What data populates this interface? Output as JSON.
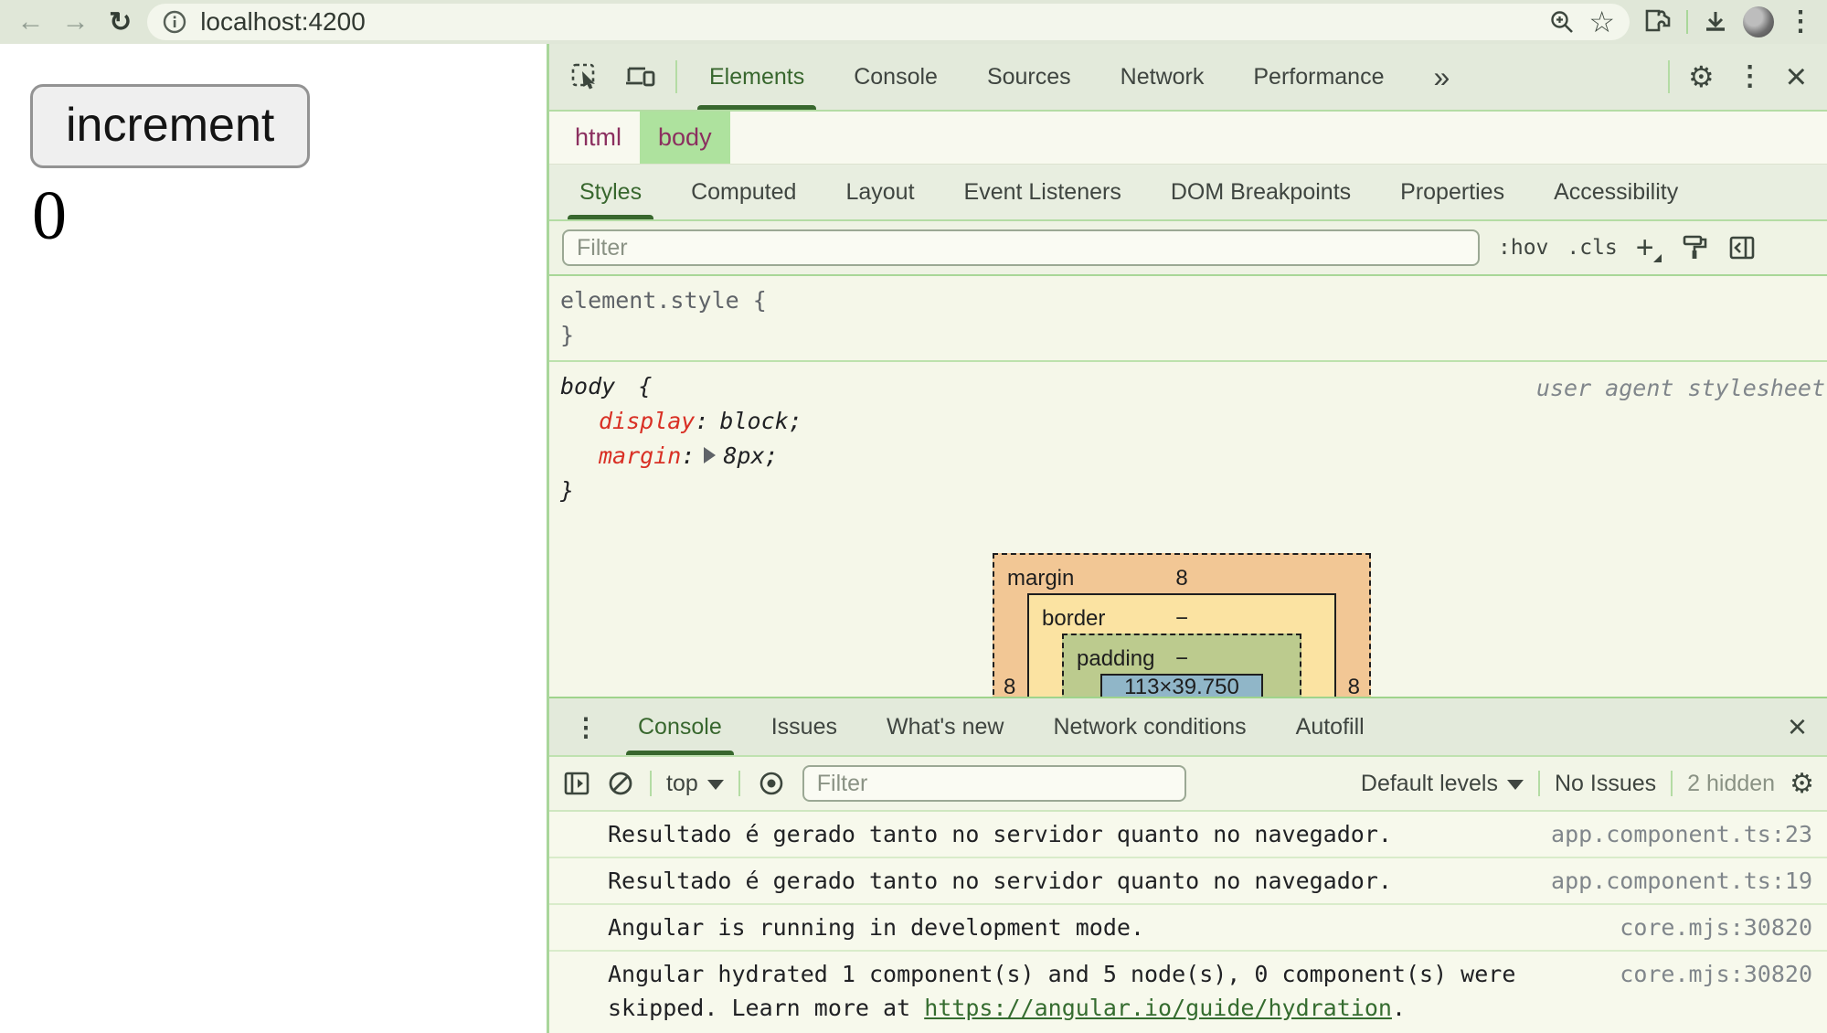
{
  "browser": {
    "url": "localhost:4200"
  },
  "page": {
    "button_label": "increment",
    "counter_value": "0"
  },
  "devtools": {
    "tabs": [
      "Elements",
      "Console",
      "Sources",
      "Network",
      "Performance"
    ],
    "more_tabs_glyph": "»",
    "breadcrumbs": [
      "html",
      "body"
    ],
    "styles_tabs": [
      "Styles",
      "Computed",
      "Layout",
      "Event Listeners",
      "DOM Breakpoints",
      "Properties",
      "Accessibility"
    ],
    "filter_placeholder": "Filter",
    "pseudo_toggle": ":hov",
    "class_toggle": ".cls",
    "plus_glyph": "+",
    "styles_pane": {
      "element_style_selector": "element.style",
      "syntax": {
        "open_brace": "{",
        "close_brace": "}",
        "colon": ":",
        "semicolon": ";"
      },
      "rule": {
        "selector": "body",
        "origin": "user agent stylesheet",
        "declarations": [
          {
            "property": "display",
            "value": "block"
          },
          {
            "property": "margin",
            "value": "8px"
          }
        ]
      }
    },
    "box_model": {
      "margin_label": "margin",
      "margin_top_value": "8",
      "margin_left_value": "8",
      "margin_right_value": "8",
      "border_label": "border",
      "border_top_value": "−",
      "padding_label": "padding",
      "padding_top_value": "−",
      "content_size": "113×39.750"
    }
  },
  "drawer": {
    "tabs": [
      "Console",
      "Issues",
      "What's new",
      "Network conditions",
      "Autofill"
    ],
    "toolbar": {
      "context_selector": "top",
      "filter_placeholder": "Filter",
      "levels_selector": "Default levels",
      "issues_label": "No Issues",
      "hidden_label": "2 hidden"
    },
    "messages": [
      {
        "text": "Resultado é gerado tanto no servidor quanto no navegador.",
        "source": "app.component.ts:23"
      },
      {
        "text": "Resultado é gerado tanto no servidor quanto no navegador.",
        "source": "app.component.ts:19"
      },
      {
        "text": "Angular is running in development mode.",
        "source": "core.mjs:30820"
      },
      {
        "text_before": "Angular hydrated 1 component(s) and 5 node(s), 0 component(s) were skipped. Learn more at ",
        "link": "https://angular.io/guide/hydration",
        "text_after": ".",
        "source": "core.mjs:30820"
      }
    ]
  },
  "colors": {
    "accent_green": "#38672e",
    "toolbar_bg": "#e3eadb",
    "browser_toolbar_bg": "#e0e7d8",
    "content_bg": "#f5f7e9",
    "tag_color": "#8b2f5f",
    "selected_crumb_bg": "#aee29e",
    "property_red": "#d93025",
    "link_green": "#356c2f",
    "box_margin": "#f2c795",
    "box_border": "#fbe3a2",
    "box_padding": "#bccb8e",
    "box_content": "#90b6c8"
  }
}
